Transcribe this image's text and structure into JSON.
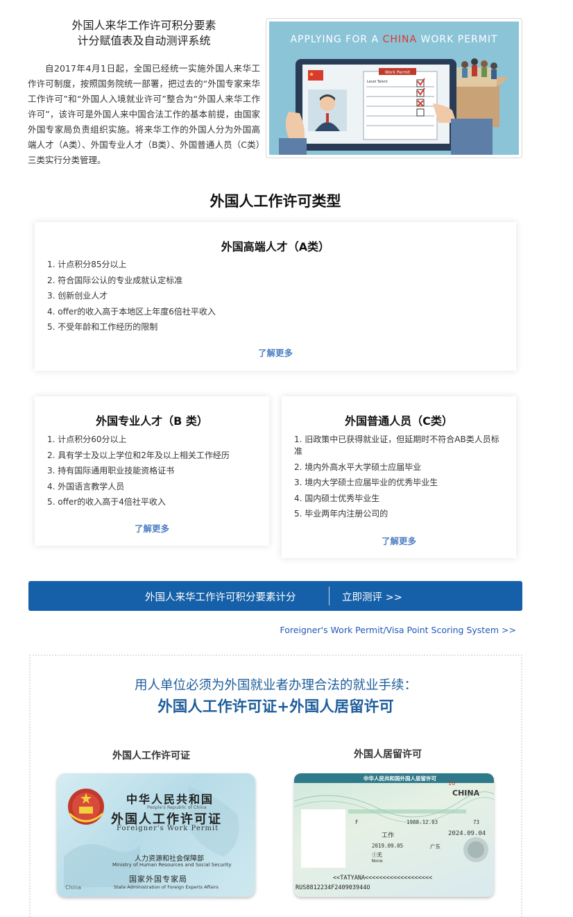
{
  "intro": {
    "title_line1": "外国人来华工作许可积分要素",
    "title_line2": "计分赋值表及自动测评系统",
    "paragraph": "自2017年4月1日起，全国已经统一实施外国人来华工作许可制度，按照国务院统一部署，把过去的“外国专家来华工作许可”和“外国人入境就业许可”整合为“外国人来华工作许可”，该许可是外国人来中国合法工作的基本前提，由国家外国专家局负责组织实施。将来华工作的外国人分为外国高端人才（A类）、外国专业人才（B类）、外国普通人员（C类）三类实行分类管理。"
  },
  "hero": {
    "title_part1": "APPLYING FOR A ",
    "title_highlight": "CHINA",
    "title_part2": " WORK PERMIT",
    "form_title": "Work Permit",
    "form_level": "Level Talent",
    "colors": {
      "background": "#8bc4d7",
      "highlight": "#d83a2e"
    }
  },
  "section_title": "外国人工作许可类型",
  "cards": {
    "a": {
      "title": "外国高端人才（A类）",
      "items": [
        "1. 计点积分85分以上",
        "2. 符合国际公认的专业成就认定标准",
        "3. 创新创业人才",
        "4. offer的收入高于本地区上年度6倍社平收入",
        "5. 不受年龄和工作经历的限制"
      ],
      "more": "了解更多"
    },
    "b": {
      "title": "外国专业人才（B 类）",
      "items": [
        "1. 计点积分60分以上",
        "2. 具有学士及以上学位和2年及以上相关工作经历",
        "3. 持有国际通用职业技能资格证书",
        "4. 外国语言教学人员",
        "5. offer的收入高于4倍社平收入"
      ],
      "more": "了解更多"
    },
    "c": {
      "title": "外国普通人员（C类）",
      "items": [
        "1. 旧政策中已获得就业证，但延期时不符合AB类人员标准",
        "2. 境内外高水平大学硕士应届毕业",
        "3. 境内大学硕士应届毕业的优秀毕业生",
        "4. 国内硕士优秀毕业生",
        "5. 毕业两年内注册公司的"
      ],
      "more": "了解更多"
    }
  },
  "banner": {
    "left_text": "外国人来华工作许可积分要素计分",
    "right_text": "立即测评 >>",
    "color": "#1560a9"
  },
  "en_link": "Foreigner's Work Permit/Visa Point Scoring System >>",
  "requirements": {
    "subtitle": "用人单位必须为外国就业者办理合法的就业手续：",
    "main": "外国人工作许可证+外国人居留许可",
    "doc1_label": "外国人工作许可证",
    "doc2_label": "外国人居留许可"
  },
  "permit_card": {
    "cn1": "中华人民共和国",
    "en1": "People's Republic of China",
    "cn2": "外国人工作许可证",
    "en2": "Foreigner's Work Permit",
    "cn3": "人力资源和社会保障部",
    "en3": "Ministry of Human Resources and Social Security",
    "cn4": "国家外国专家局",
    "en4": "State Administration of Foreign Experts Affairs",
    "china": "China"
  },
  "visa": {
    "title": "中华人民共和国外国人居留许可",
    "number": "10",
    "china": "CHINA",
    "sex": "F",
    "birth": "1988.12.03",
    "code": "73",
    "purpose": "工作",
    "expiry": "2024.09.04",
    "issued": "2019.09.05",
    "place": "广东",
    "entries": "①无",
    "entries_en": "None",
    "mrz1": "<<TATYANA<<<<<<<<<<<<<<<<<<<",
    "mrz2": "RUS8812234F240903944O"
  }
}
